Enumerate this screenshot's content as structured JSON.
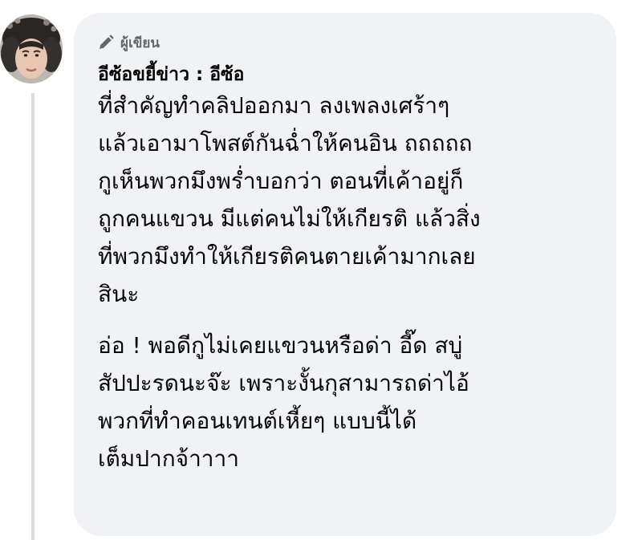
{
  "comment": {
    "author_badge": "ผู้เขียน",
    "author_name": "อีซ้อขยี้ข่าว : อีซ้อ",
    "paragraphs": [
      [
        "ที่สำคัญทำคลิปออกมา ลงเพลงเศร้าๆ",
        "แล้วเอามาโพสต์กันฉ่ำให้คนอิน ถถถถถ",
        "กูเห็นพวกมึงพร่ำบอกว่า ตอนที่เค้าอยู่ก็",
        "ถูกคนแขวน มีแต่คนไม่ให้เกียรติ แล้วสิ่ง",
        "ที่พวกมึงทำให้เกียรติคนตายเค้ามากเลย",
        "สินะ"
      ],
      [
        "อ่อ ! พอดีกูไม่เคยแขวนหรือด่า อี๊ด สบู่",
        "สัปปะรดนะจ๊ะ เพราะงั้นกุสามารถด่าไอ้",
        "พวกที่ทำคอนเทนต์เหี้ยๆ แบบนี้ได้",
        "เต็มปากจ้าาาา"
      ]
    ]
  }
}
